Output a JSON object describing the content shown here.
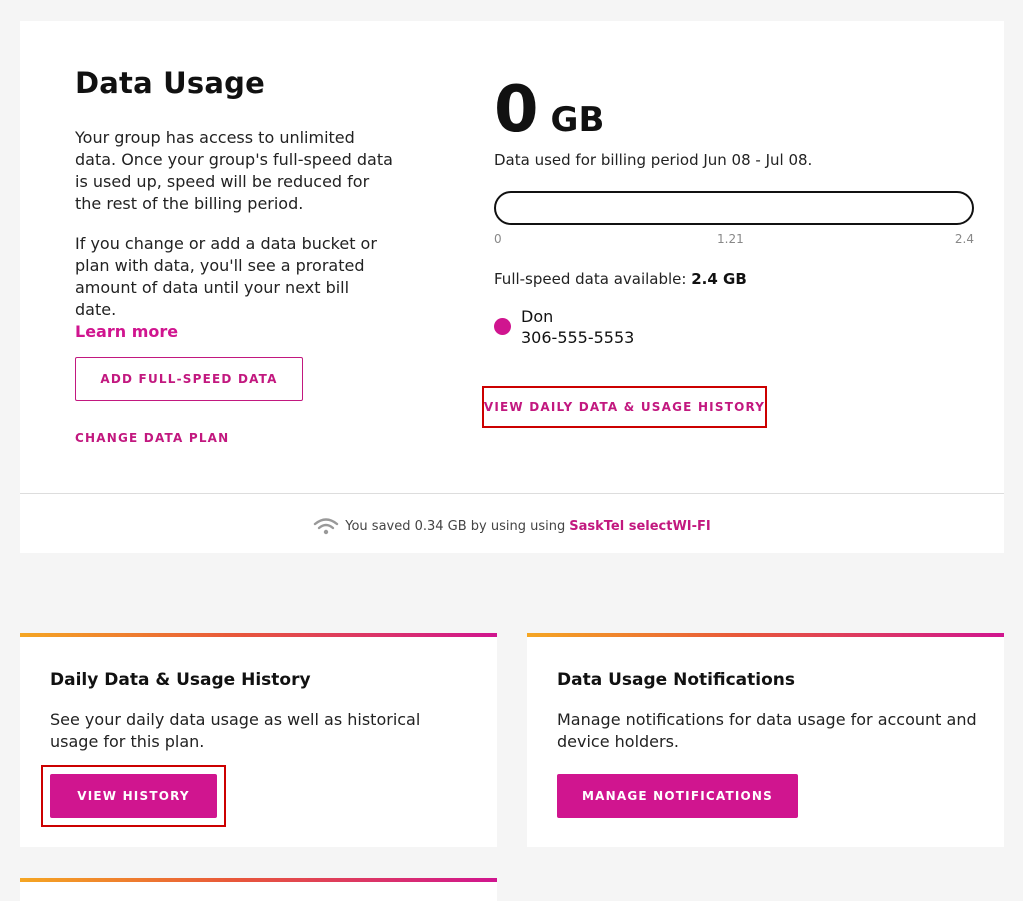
{
  "data_usage": {
    "title": "Data Usage",
    "description_1": "Your group has access to unlimited data. Once your group's full-speed data is used up, speed will be reduced for the rest of the billing period.",
    "description_2": "If you change or add a data bucket or plan with data, you'll see a prorated amount of data until your next bill date.",
    "learn_more": "Learn more",
    "add_button": "ADD FULL-SPEED DATA",
    "change_plan_link": "CHANGE DATA PLAN",
    "used_value": "0",
    "used_unit": "GB",
    "period_text": "Data used for billing period Jun 08 - Jul 08.",
    "usage_bar": {
      "used": 0,
      "max": 2.4,
      "fill_color": "#d0158f"
    },
    "ticks": [
      "0",
      "1.21",
      "2.4"
    ],
    "full_speed_label": "Full-speed data available:",
    "full_speed_value": "2.4 GB",
    "member": {
      "name": "Don",
      "phone": "306-555-5553",
      "color": "#d0158f"
    },
    "history_link": "VIEW DAILY DATA & USAGE HISTORY",
    "wifi_text": "You saved 0.34 GB by using using",
    "wifi_brand": "SaskTel selectWI-FI"
  },
  "cards": [
    {
      "title": "Daily Data & Usage History",
      "description": "See your daily data usage as well as historical usage for this plan.",
      "button": "VIEW HISTORY"
    },
    {
      "title": "Data Usage Notifications",
      "description": "Manage notifications for data usage for account and device holders.",
      "button": "MANAGE NOTIFICATIONS"
    }
  ],
  "colors": {
    "accent": "#d0158f",
    "link": "#c2187f",
    "highlight": "#cc0000",
    "gradient_start": "#f5a623",
    "gradient_end": "#d0158f"
  }
}
